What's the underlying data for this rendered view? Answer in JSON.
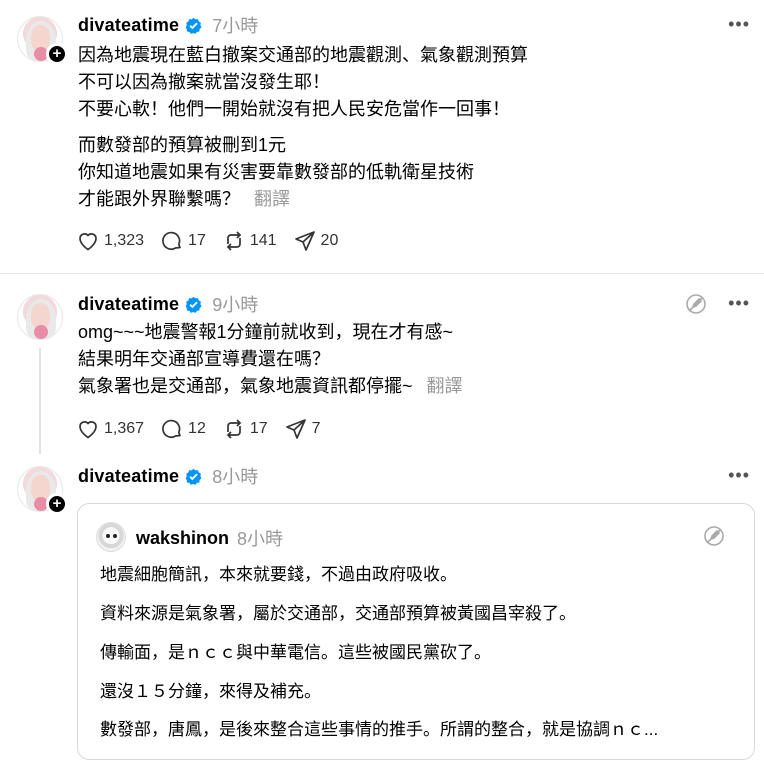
{
  "posts": [
    {
      "username": "divateatime",
      "time": "7小時",
      "paragraphs": [
        [
          "因為地震現在藍白撤案交通部的地震觀測、氣象觀測預算",
          "不可以因為撤案就當沒發生耶！",
          "不要心軟！他們一開始就沒有把人民安危當作一回事！"
        ],
        [
          "而數發部的預算被刪到1元",
          "你知道地震如果有災害要靠數發部的低軌衛星技術",
          "才能跟外界聯繫嗎？"
        ]
      ],
      "translate": "翻譯",
      "likes": "1,323",
      "comments": "17",
      "reposts": "141",
      "shares": "20"
    },
    {
      "username": "divateatime",
      "time": "9小時",
      "lines": [
        "omg~~~地震警報1分鐘前就收到，現在才有感~",
        "結果明年交通部宣導費還在嗎？",
        "氣象署也是交通部，氣象地震資訊都停擺~"
      ],
      "translate": "翻譯",
      "likes": "1,367",
      "comments": "12",
      "reposts": "17",
      "shares": "7"
    },
    {
      "username": "divateatime",
      "time": "8小時",
      "quote": {
        "username": "wakshinon",
        "time": "8小時",
        "lines": [
          "地震細胞簡訊，本來就要錢，不過由政府吸收。",
          "資料來源是氣象署，屬於交通部，交通部預算被黃國昌宰殺了。",
          "傳輸面，是ｎｃｃ與中華電信。這些被國民黨砍了。",
          "還沒１５分鐘，來得及補充。",
          "數發部，唐鳳，是後來整合這些事情的推手。所謂的整合，就是協調ｎｃ..."
        ]
      }
    }
  ],
  "more_label": "•••",
  "colors": {
    "verified": "#0095f6",
    "secondary": "#999999"
  }
}
